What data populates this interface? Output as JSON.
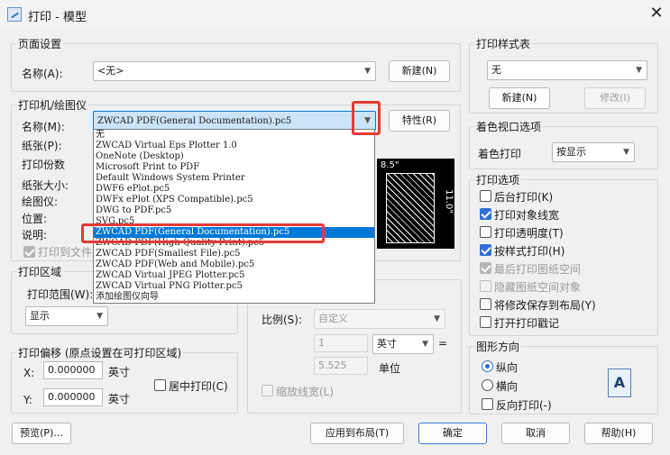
{
  "window": {
    "title": "打印 - 模型",
    "close_glyph": "✕"
  },
  "page_setup": {
    "group_label": "页面设置",
    "name_label": "名称(A):",
    "name_value": "<无>",
    "new_button": "新建(N)"
  },
  "printer": {
    "group_label": "打印机/绘图仪",
    "name_label": "名称(M):",
    "name_value": "ZWCAD PDF(General Documentation).pc5",
    "properties_button": "特性(R)",
    "paper_label": "纸张(P):",
    "copies_label": "打印份数",
    "paper_size_label": "纸张大小:",
    "plotter_label": "绘图仪:",
    "where_label": "位置:",
    "description_label": "说明:",
    "print_to_file_label": "打印到文件",
    "preview_width": "8.5\"",
    "preview_height": "11.0\""
  },
  "printer_dropdown": {
    "options": [
      "无",
      "ZWCAD Virtual Eps Plotter 1.0",
      "OneNote (Desktop)",
      "Microsoft Print to PDF",
      "Default Windows System Printer",
      "DWF6 ePlot.pc5",
      "DWFx ePlot (XPS Compatible).pc5",
      "DWG to PDF.pc5",
      "SVG.pc5",
      "ZWCAD PDF(General Documentation).pc5",
      "ZWCAD PDF(High Quality Print).pc5",
      "ZWCAD PDF(Smallest File).pc5",
      "ZWCAD PDF(Web and Mobile).pc5",
      "ZWCAD Virtual JPEG Plotter.pc5",
      "ZWCAD Virtual PNG Plotter.pc5",
      "添加绘图仪向导"
    ],
    "selected_index": 9
  },
  "print_area": {
    "group_label": "打印区域",
    "range_label": "打印范围(W):",
    "range_value": "显示"
  },
  "print_offset": {
    "group_label": "打印偏移 (原点设置在可打印区域)",
    "x_label": "X:",
    "x_value": "0.000000",
    "y_label": "Y:",
    "y_value": "0.000000",
    "unit": "英寸",
    "center_label": "居中打印(C)"
  },
  "scale": {
    "scale_label": "比例(S):",
    "scale_value": "自定义",
    "value1": "1",
    "unit_select": "英寸",
    "equals": "=",
    "value2": "5.525",
    "unit_label": "单位",
    "scale_lineweights": "缩放线宽(L)"
  },
  "plot_style": {
    "group_label": "打印样式表",
    "value": "无",
    "new_button": "新建(N)",
    "edit_button": "修改(I)"
  },
  "shaded": {
    "group_label": "着色视口选项",
    "shade_label": "着色打印",
    "shade_value": "按显示"
  },
  "options": {
    "group_label": "打印选项",
    "items": [
      {
        "label": "后台打印(K)",
        "checked": false,
        "disabled": false
      },
      {
        "label": "打印对象线宽",
        "checked": true,
        "disabled": false
      },
      {
        "label": "打印透明度(T)",
        "checked": false,
        "disabled": false
      },
      {
        "label": "按样式打印(H)",
        "checked": true,
        "disabled": false
      },
      {
        "label": "最后打印图纸空间",
        "checked": true,
        "disabled": true
      },
      {
        "label": "隐藏图纸空间对象",
        "checked": false,
        "disabled": true
      },
      {
        "label": "将修改保存到布局(Y)",
        "checked": false,
        "disabled": false
      },
      {
        "label": "打开打印戳记",
        "checked": false,
        "disabled": false
      }
    ]
  },
  "orientation": {
    "group_label": "图形方向",
    "portrait": "纵向",
    "landscape": "横向",
    "reverse": "反向打印(-)",
    "icon_letter": "A"
  },
  "footer": {
    "preview_button": "预览(P)...",
    "apply_button": "应用到布局(T)",
    "ok_button": "确定",
    "cancel_button": "取消",
    "help_button": "帮助(H)"
  }
}
